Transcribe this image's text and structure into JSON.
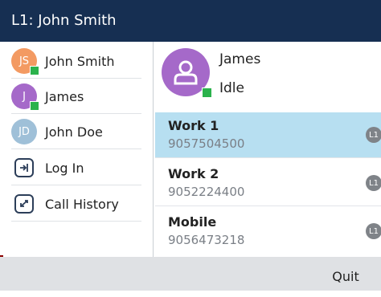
{
  "header": {
    "title": "L1: John Smith"
  },
  "sidebar": {
    "items": [
      {
        "label": "John Smith",
        "initials": "JS",
        "avatar_color": "#f39a62",
        "presence": "available"
      },
      {
        "label": "James",
        "initials": "J",
        "avatar_color": "#a569c9",
        "presence": "available"
      },
      {
        "label": "John Doe",
        "initials": "JD",
        "avatar_color": "#9fc0d8",
        "presence": "none"
      },
      {
        "label": "Log In",
        "icon": "login-icon"
      },
      {
        "label": "Call History",
        "icon": "call-history-icon"
      }
    ]
  },
  "contact": {
    "name": "James",
    "status": "Idle",
    "avatar_color": "#a569c9",
    "presence_color": "#2bb24c",
    "numbers": [
      {
        "label": "Work 1",
        "number": "9057504500",
        "line": "L1",
        "selected": true
      },
      {
        "label": "Work 2",
        "number": "9052224400",
        "line": "L1",
        "selected": false
      },
      {
        "label": "Mobile",
        "number": "9056473218",
        "line": "L1",
        "selected": false
      }
    ]
  },
  "footer": {
    "softkey": "Quit"
  },
  "colors": {
    "titlebar": "#162f52",
    "selected_row": "#b7dff1",
    "footer": "#dfe1e4"
  }
}
